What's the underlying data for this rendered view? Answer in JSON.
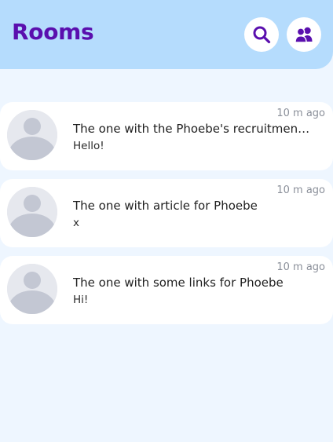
{
  "header": {
    "title": "Rooms",
    "search_icon": "search-icon",
    "users_icon": "users-icon",
    "accent_color": "#5a0fae",
    "background_color": "#b5dcfd"
  },
  "rooms": [
    {
      "time": "10 m ago",
      "name": "The one with the Phoebe's recruitment...",
      "last_message": "Hello!"
    },
    {
      "time": "10 m ago",
      "name": "The one with article for Phoebe",
      "last_message": "x"
    },
    {
      "time": "10 m ago",
      "name": "The one with some links for Phoebe",
      "last_message": "Hi!"
    }
  ]
}
